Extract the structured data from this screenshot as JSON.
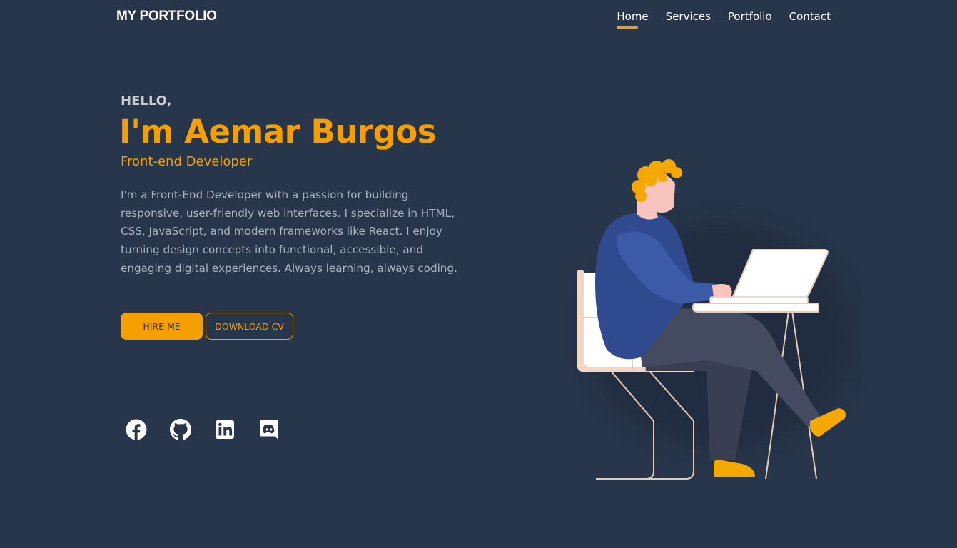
{
  "header": {
    "logo": "MY PORTFOLIO",
    "nav": [
      {
        "label": "Home",
        "active": true
      },
      {
        "label": "Services"
      },
      {
        "label": "Portfolio"
      },
      {
        "label": "Contact"
      }
    ]
  },
  "hero": {
    "greeting": "HELLO,",
    "name": "I'm Aemar Burgos",
    "role": "Front-end Developer",
    "bio": "I'm a Front-End Developer with a passion for building responsive, user-friendly web interfaces. I specialize in HTML, CSS, JavaScript, and modern frameworks like React. I enjoy turning design concepts into functional, accessible, and engaging digital experiences. Always learning, always coding.",
    "hire_button": "HIRE ME",
    "cv_button": "DOWNLOAD CV"
  },
  "socials": [
    {
      "icon": "facebook-icon"
    },
    {
      "icon": "github-icon"
    },
    {
      "icon": "linkedin-icon"
    },
    {
      "icon": "discord-icon"
    }
  ],
  "colors": {
    "background": "#27364a",
    "accent": "#f59f00",
    "text_muted": "#aab4c1"
  }
}
